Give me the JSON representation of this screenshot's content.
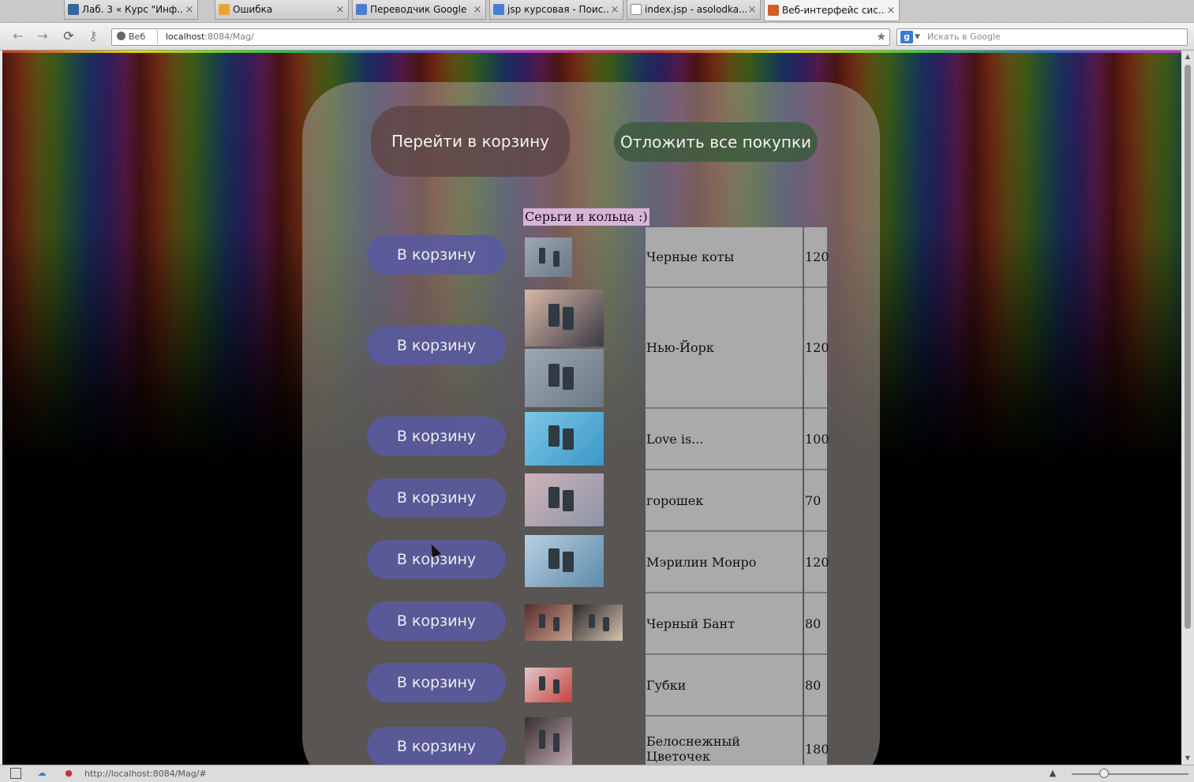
{
  "tabs": [
    {
      "label": "Лаб. 3 « Курс \"Инф...",
      "favicon_color": "#3465a4"
    },
    {
      "label": "Ошибка",
      "favicon_color": "#e8a43b"
    },
    {
      "label": "Переводчик Google",
      "favicon_color": "#4a7fd0"
    },
    {
      "label": "jsp курсовая - Поис...",
      "favicon_color": "#4a7fd0"
    },
    {
      "label": "index.jsp - asolodka...",
      "favicon_color": "#ffffff"
    },
    {
      "label": "Веб-интерфейс сис...",
      "favicon_color": "#d35b2a"
    }
  ],
  "addressbar": {
    "web_chip": "Веб",
    "url_host": "localhost",
    "url_rest": ":8084/Mag/",
    "search_placeholder": "Искать в Google",
    "search_engine_letter": "g"
  },
  "page": {
    "go_to_cart": "Перейти в корзину",
    "defer_all": "Отложить все покупки",
    "table_title": "Серьги и кольца :)",
    "add_to_cart_label": "В корзину",
    "products": [
      {
        "name": "Черные коты",
        "price": "120"
      },
      {
        "name": "Нью-Йорк",
        "price": "120"
      },
      {
        "name": "Love is...",
        "price": "100"
      },
      {
        "name": "горошек",
        "price": "70"
      },
      {
        "name": "Мэрилин Монро",
        "price": "120"
      },
      {
        "name": "Черный Бант",
        "price": "80"
      },
      {
        "name": "Губки",
        "price": "80"
      },
      {
        "name": "Белоснежный Цветочек",
        "price": "180"
      }
    ]
  },
  "statusbar": {
    "link_preview": "http://localhost:8084/Mag/#"
  },
  "colors": {
    "add_button": "#5a5aa0",
    "cell_bg": "#aaaaaa",
    "title_bg": "#d8b4d8"
  }
}
